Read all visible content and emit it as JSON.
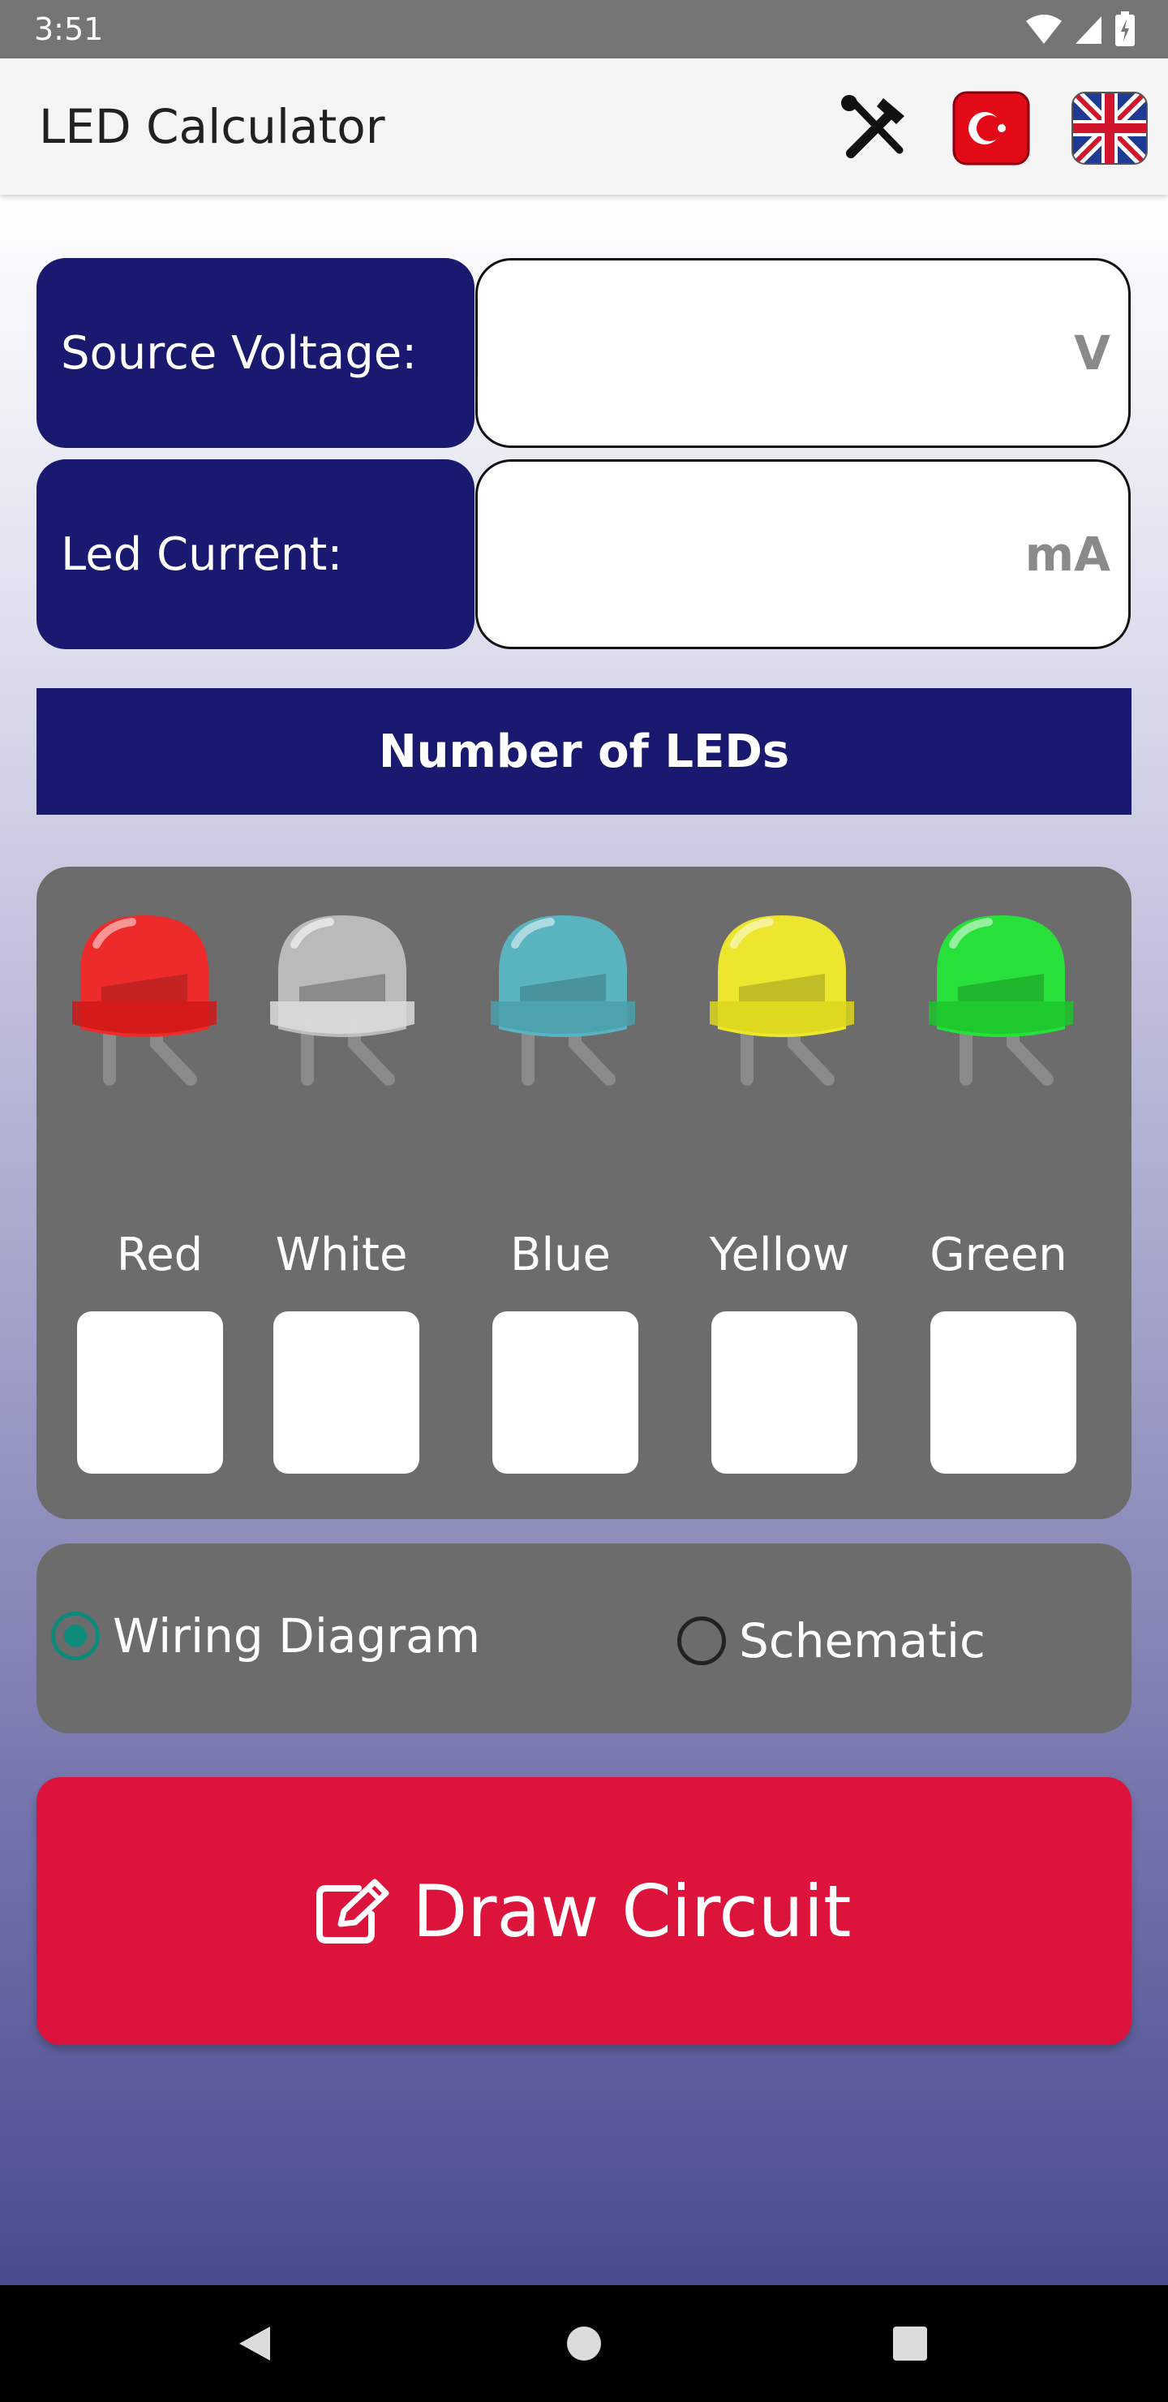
{
  "status_bar": {
    "time": "3:51",
    "icons": [
      "wifi-icon",
      "signal-icon",
      "battery-icon"
    ]
  },
  "app_bar": {
    "title": "LED Calculator",
    "actions": [
      "tools-icon",
      "turkish-flag-icon",
      "uk-flag-icon"
    ]
  },
  "inputs": {
    "source_voltage": {
      "label": "Source Voltage:",
      "value": "",
      "unit": "V"
    },
    "led_current": {
      "label": "Led Current:",
      "value": "",
      "unit": "mA"
    }
  },
  "banner": {
    "text": "Number of LEDs"
  },
  "leds": [
    {
      "label": "Red",
      "color": "#ee2b2b",
      "value": ""
    },
    {
      "label": "White",
      "color": "#c8c8c8",
      "value": ""
    },
    {
      "label": "Blue",
      "color": "#5ab4c0",
      "value": ""
    },
    {
      "label": "Yellow",
      "color": "#ece72e",
      "value": ""
    },
    {
      "label": "Green",
      "color": "#28e03a",
      "value": ""
    }
  ],
  "diagram_type": {
    "options": [
      "Wiring Diagram",
      "Schematic"
    ],
    "selected": "Wiring Diagram"
  },
  "draw_button": {
    "label": "Draw Circuit",
    "icon": "edit-icon"
  },
  "colors": {
    "label_bg": "#191970",
    "panel_bg": "#6c6c6c",
    "button_bg": "#dc143c",
    "radio_selected": "#0e8a7a"
  }
}
